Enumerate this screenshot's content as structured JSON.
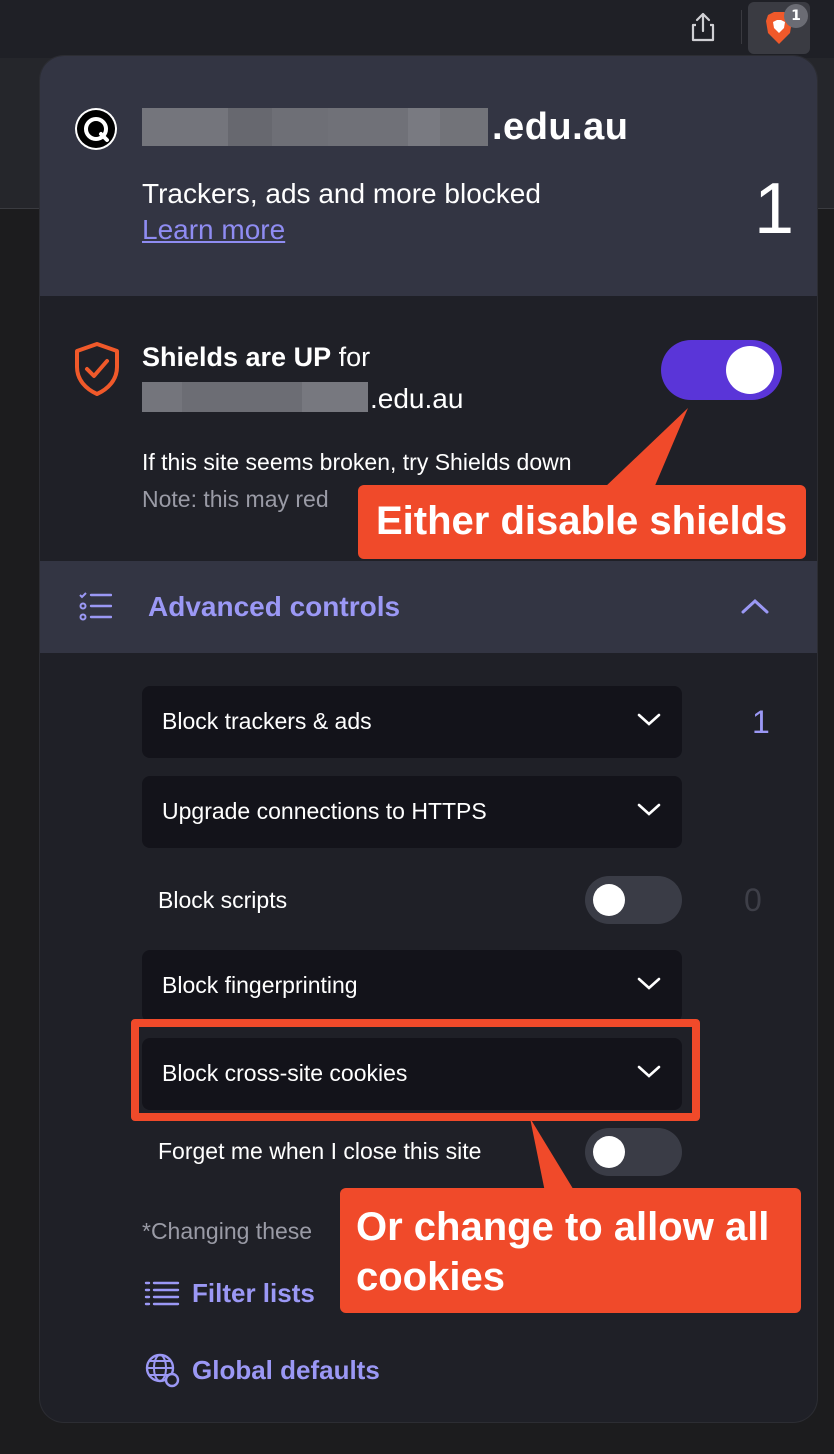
{
  "browser": {
    "share_icon": "share-icon",
    "brave_icon": "brave-lion-icon",
    "badge_count": "1"
  },
  "header": {
    "domain_suffix": ".edu.au",
    "blocked_text": "Trackers, ads and more blocked",
    "learn_more": "Learn more",
    "blocked_count": "1"
  },
  "shields": {
    "status_bold": "Shields are UP",
    "status_rest": " for",
    "domain_suffix": ".edu.au",
    "enabled": true,
    "hint": "If this site seems broken, try Shields down",
    "note": "Note: this may red"
  },
  "advanced": {
    "label": "Advanced controls",
    "expanded": true
  },
  "controls": [
    {
      "label": "Block trackers & ads",
      "type": "dropdown",
      "count": "1"
    },
    {
      "label": "Upgrade connections to HTTPS",
      "type": "dropdown"
    },
    {
      "label": "Block scripts",
      "type": "toggle",
      "on": false,
      "count": "0"
    },
    {
      "label": "Block fingerprinting",
      "type": "dropdown"
    },
    {
      "label": "Block cross-site cookies",
      "type": "dropdown"
    },
    {
      "label": "Forget me when I close this site",
      "type": "toggle",
      "on": false
    }
  ],
  "footnote": "*Changing these",
  "links": {
    "filter_lists": "Filter lists",
    "global_defaults": "Global defaults"
  },
  "annotations": {
    "callout_shields": "Either disable shields",
    "callout_cookies": "Or change to allow all cookies"
  },
  "colors": {
    "accent": "#5a35d8",
    "link": "#9b98f5",
    "annotation": "#f04a2a",
    "shield": "#f0592a"
  }
}
